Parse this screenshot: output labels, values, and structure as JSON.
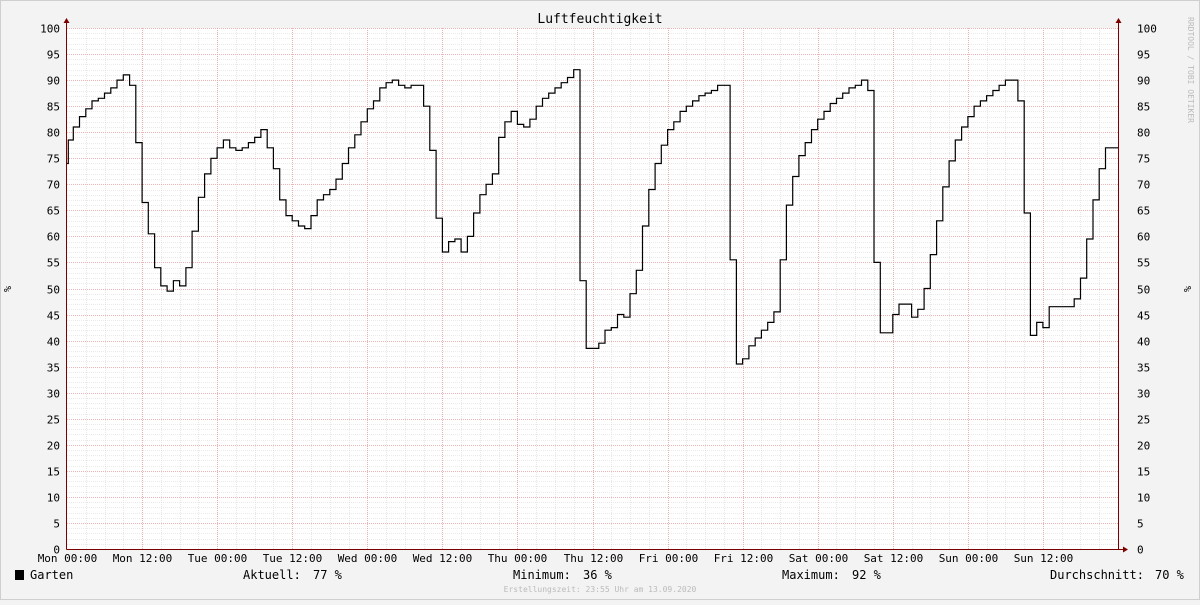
{
  "chart_data": {
    "type": "line",
    "title": "Luftfeuchtigkeit",
    "ylabel": "%",
    "ylim": [
      0,
      100
    ],
    "yticks": [
      0,
      5,
      10,
      15,
      20,
      25,
      30,
      35,
      40,
      45,
      50,
      55,
      60,
      65,
      70,
      75,
      80,
      85,
      90,
      95,
      100
    ],
    "xlabels": [
      "Mon 00:00",
      "Mon 12:00",
      "Tue 00:00",
      "Tue 12:00",
      "Wed 00:00",
      "Wed 12:00",
      "Thu 00:00",
      "Thu 12:00",
      "Fri 00:00",
      "Fri 12:00",
      "Sat 00:00",
      "Sat 12:00",
      "Sun 00:00",
      "Sun 12:00"
    ],
    "x_unit": "hours since Mon 00:00",
    "xlim": [
      0,
      168
    ],
    "grid": true,
    "series": [
      {
        "name": "Garten",
        "color": "#000000",
        "step": true,
        "points": [
          [
            0,
            74
          ],
          [
            0.2,
            78.5
          ],
          [
            1,
            81
          ],
          [
            2,
            83
          ],
          [
            3,
            84.5
          ],
          [
            4,
            86
          ],
          [
            5,
            86.5
          ],
          [
            6,
            87.5
          ],
          [
            7,
            88.5
          ],
          [
            8,
            90
          ],
          [
            9,
            91
          ],
          [
            10,
            89
          ],
          [
            11,
            78
          ],
          [
            12,
            66.5
          ],
          [
            13,
            60.5
          ],
          [
            14,
            54
          ],
          [
            15,
            50.5
          ],
          [
            16,
            49.5
          ],
          [
            17,
            51.5
          ],
          [
            18,
            50.5
          ],
          [
            19,
            54
          ],
          [
            20,
            61
          ],
          [
            21,
            67.5
          ],
          [
            22,
            72
          ],
          [
            23,
            75
          ],
          [
            24,
            77
          ],
          [
            25,
            78.5
          ],
          [
            26,
            77
          ],
          [
            27,
            76.5
          ],
          [
            28,
            77
          ],
          [
            29,
            78
          ],
          [
            30,
            79
          ],
          [
            31,
            80.5
          ],
          [
            32,
            77
          ],
          [
            33,
            73
          ],
          [
            34,
            67
          ],
          [
            35,
            64
          ],
          [
            36,
            63
          ],
          [
            37,
            62
          ],
          [
            38,
            61.5
          ],
          [
            39,
            64
          ],
          [
            40,
            67
          ],
          [
            41,
            68
          ],
          [
            42,
            69
          ],
          [
            43,
            71
          ],
          [
            44,
            74
          ],
          [
            45,
            77
          ],
          [
            46,
            79.5
          ],
          [
            47,
            82
          ],
          [
            48,
            84.5
          ],
          [
            49,
            86
          ],
          [
            50,
            88.5
          ],
          [
            51,
            89.5
          ],
          [
            52,
            90
          ],
          [
            53,
            89
          ],
          [
            54,
            88.5
          ],
          [
            55,
            89
          ],
          [
            56,
            89
          ],
          [
            57,
            85
          ],
          [
            58,
            76.5
          ],
          [
            59,
            63.5
          ],
          [
            60,
            57
          ],
          [
            61,
            59
          ],
          [
            62,
            59.5
          ],
          [
            63,
            57
          ],
          [
            64,
            60
          ],
          [
            65,
            64.5
          ],
          [
            66,
            68
          ],
          [
            67,
            70
          ],
          [
            68,
            72
          ],
          [
            69,
            79
          ],
          [
            70,
            82
          ],
          [
            71,
            84
          ],
          [
            72,
            81.5
          ],
          [
            73,
            81
          ],
          [
            74,
            82.5
          ],
          [
            75,
            85
          ],
          [
            76,
            86.5
          ],
          [
            77,
            87.5
          ],
          [
            78,
            88.5
          ],
          [
            79,
            89.5
          ],
          [
            80,
            90.5
          ],
          [
            81,
            92
          ],
          [
            82,
            51.5
          ],
          [
            83,
            38.5
          ],
          [
            84,
            38.5
          ],
          [
            85,
            39.5
          ],
          [
            86,
            42
          ],
          [
            87,
            42.5
          ],
          [
            88,
            45
          ],
          [
            89,
            44.5
          ],
          [
            90,
            49
          ],
          [
            91,
            53.5
          ],
          [
            92,
            62
          ],
          [
            93,
            69
          ],
          [
            94,
            74
          ],
          [
            95,
            77.5
          ],
          [
            96,
            80.5
          ],
          [
            97,
            82
          ],
          [
            98,
            84
          ],
          [
            99,
            85
          ],
          [
            100,
            86
          ],
          [
            101,
            87
          ],
          [
            102,
            87.5
          ],
          [
            103,
            88
          ],
          [
            104,
            89
          ],
          [
            105,
            89
          ],
          [
            106,
            55.5
          ],
          [
            107,
            35.5
          ],
          [
            108,
            36.5
          ],
          [
            109,
            39
          ],
          [
            110,
            40.5
          ],
          [
            111,
            42
          ],
          [
            112,
            43.5
          ],
          [
            113,
            45.5
          ],
          [
            114,
            55.5
          ],
          [
            115,
            66
          ],
          [
            116,
            71.5
          ],
          [
            117,
            75.5
          ],
          [
            118,
            78
          ],
          [
            119,
            80.5
          ],
          [
            120,
            82.5
          ],
          [
            121,
            84
          ],
          [
            122,
            85.5
          ],
          [
            123,
            86.5
          ],
          [
            124,
            87.5
          ],
          [
            125,
            88.5
          ],
          [
            126,
            89
          ],
          [
            127,
            90
          ],
          [
            128,
            88
          ],
          [
            129,
            55
          ],
          [
            130,
            41.5
          ],
          [
            131,
            41.5
          ],
          [
            132,
            45
          ],
          [
            133,
            47
          ],
          [
            134,
            47
          ],
          [
            135,
            44.5
          ],
          [
            136,
            46
          ],
          [
            137,
            50
          ],
          [
            138,
            56.5
          ],
          [
            139,
            63
          ],
          [
            140,
            69.5
          ],
          [
            141,
            74.5
          ],
          [
            142,
            78.5
          ],
          [
            143,
            81
          ],
          [
            144,
            83
          ],
          [
            145,
            85
          ],
          [
            146,
            86
          ],
          [
            147,
            87
          ],
          [
            148,
            88
          ],
          [
            149,
            89
          ],
          [
            150,
            90
          ],
          [
            151,
            90
          ],
          [
            152,
            86
          ],
          [
            153,
            64.5
          ],
          [
            154,
            41
          ],
          [
            155,
            43.5
          ],
          [
            156,
            42.5
          ],
          [
            157,
            46.5
          ],
          [
            158,
            46.5
          ],
          [
            159,
            46.5
          ],
          [
            160,
            46.5
          ],
          [
            161,
            48
          ],
          [
            162,
            52
          ],
          [
            163,
            59.5
          ],
          [
            164,
            67
          ],
          [
            165,
            73
          ],
          [
            166,
            77
          ],
          [
            167,
            77
          ]
        ]
      }
    ]
  },
  "legend": {
    "series_name": "Garten",
    "series_color": "#000000",
    "current_label": "Aktuell:",
    "current_value": "77 %",
    "min_label": "Minimum:",
    "min_value": "36 %",
    "max_label": "Maximum:",
    "max_value": "92 %",
    "avg_label": "Durchschnitt:",
    "avg_value": "70 %"
  },
  "footer": {
    "created": "Erstellungszeit: 23:55 Uhr am 13.09.2020"
  },
  "watermark": "RRDTOOL / TOBI OETIKER",
  "colors": {
    "background": "#f3f3f3",
    "canvas": "#ffffff",
    "major_grid": "#e8a0a0",
    "minor_grid": "#d8d8d8",
    "axis": "#7a0000",
    "text": "#000000"
  }
}
